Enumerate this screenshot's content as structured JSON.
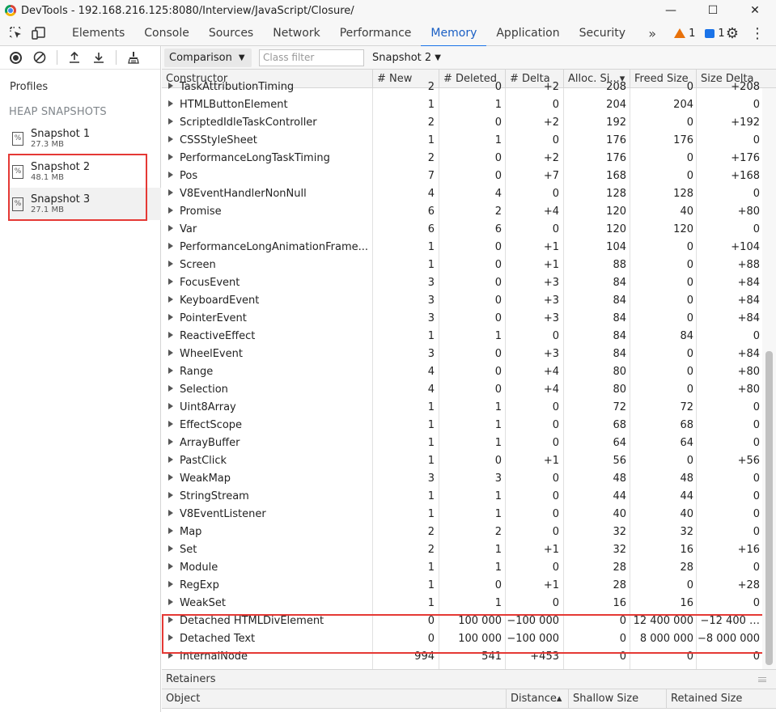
{
  "window": {
    "title": "DevTools - 192.168.216.125:8080/Interview/JavaScript/Closure/",
    "minimize": "—",
    "maximize": "☐",
    "close": "✕"
  },
  "tabs": [
    {
      "label": "Elements",
      "active": false
    },
    {
      "label": "Console",
      "active": false
    },
    {
      "label": "Sources",
      "active": false
    },
    {
      "label": "Network",
      "active": false
    },
    {
      "label": "Performance",
      "active": false
    },
    {
      "label": "Memory",
      "active": true
    },
    {
      "label": "Application",
      "active": false
    },
    {
      "label": "Security",
      "active": false
    }
  ],
  "tabbar": {
    "more": "»",
    "warnings": "1",
    "messages": "1",
    "warning_color": "#e8710a",
    "message_color": "#1a73e8",
    "accent_color": "#1a73e8"
  },
  "sidebar": {
    "profiles_label": "Profiles",
    "section_label": "HEAP SNAPSHOTS",
    "snapshots": [
      {
        "name": "Snapshot 1",
        "size": "27.3 MB"
      },
      {
        "name": "Snapshot 2",
        "size": "48.1 MB"
      },
      {
        "name": "Snapshot 3",
        "size": "27.1 MB"
      }
    ],
    "highlight_color": "#e53935"
  },
  "toolbar": {
    "view_mode": "Comparison",
    "class_filter_placeholder": "Class filter",
    "compare_target": "Snapshot 2"
  },
  "table": {
    "columns": [
      "Constructor",
      "# New",
      "# Deleted",
      "# Delta",
      "Alloc. Si...▾",
      "Freed Size",
      "Size Delta"
    ],
    "rows": [
      [
        "TaskAttributionTiming",
        "2",
        "0",
        "+2",
        "208",
        "0",
        "+208"
      ],
      [
        "HTMLButtonElement",
        "1",
        "1",
        "0",
        "204",
        "204",
        "0"
      ],
      [
        "ScriptedIdleTaskController",
        "2",
        "0",
        "+2",
        "192",
        "0",
        "+192"
      ],
      [
        "CSSStyleSheet",
        "1",
        "1",
        "0",
        "176",
        "176",
        "0"
      ],
      [
        "PerformanceLongTaskTiming",
        "2",
        "0",
        "+2",
        "176",
        "0",
        "+176"
      ],
      [
        "Pos",
        "7",
        "0",
        "+7",
        "168",
        "0",
        "+168"
      ],
      [
        "V8EventHandlerNonNull",
        "4",
        "4",
        "0",
        "128",
        "128",
        "0"
      ],
      [
        "Promise",
        "6",
        "2",
        "+4",
        "120",
        "40",
        "+80"
      ],
      [
        "Var",
        "6",
        "6",
        "0",
        "120",
        "120",
        "0"
      ],
      [
        "PerformanceLongAnimationFrame...",
        "1",
        "0",
        "+1",
        "104",
        "0",
        "+104"
      ],
      [
        "Screen",
        "1",
        "0",
        "+1",
        "88",
        "0",
        "+88"
      ],
      [
        "FocusEvent",
        "3",
        "0",
        "+3",
        "84",
        "0",
        "+84"
      ],
      [
        "KeyboardEvent",
        "3",
        "0",
        "+3",
        "84",
        "0",
        "+84"
      ],
      [
        "PointerEvent",
        "3",
        "0",
        "+3",
        "84",
        "0",
        "+84"
      ],
      [
        "ReactiveEffect",
        "1",
        "1",
        "0",
        "84",
        "84",
        "0"
      ],
      [
        "WheelEvent",
        "3",
        "0",
        "+3",
        "84",
        "0",
        "+84"
      ],
      [
        "Range",
        "4",
        "0",
        "+4",
        "80",
        "0",
        "+80"
      ],
      [
        "Selection",
        "4",
        "0",
        "+4",
        "80",
        "0",
        "+80"
      ],
      [
        "Uint8Array",
        "1",
        "1",
        "0",
        "72",
        "72",
        "0"
      ],
      [
        "EffectScope",
        "1",
        "1",
        "0",
        "68",
        "68",
        "0"
      ],
      [
        "ArrayBuffer",
        "1",
        "1",
        "0",
        "64",
        "64",
        "0"
      ],
      [
        "PastClick",
        "1",
        "0",
        "+1",
        "56",
        "0",
        "+56"
      ],
      [
        "WeakMap",
        "3",
        "3",
        "0",
        "48",
        "48",
        "0"
      ],
      [
        "StringStream",
        "1",
        "1",
        "0",
        "44",
        "44",
        "0"
      ],
      [
        "V8EventListener",
        "1",
        "1",
        "0",
        "40",
        "40",
        "0"
      ],
      [
        "Map",
        "2",
        "2",
        "0",
        "32",
        "32",
        "0"
      ],
      [
        "Set",
        "2",
        "1",
        "+1",
        "32",
        "16",
        "+16"
      ],
      [
        "Module",
        "1",
        "1",
        "0",
        "28",
        "28",
        "0"
      ],
      [
        "RegExp",
        "1",
        "0",
        "+1",
        "28",
        "0",
        "+28"
      ],
      [
        "WeakSet",
        "1",
        "1",
        "0",
        "16",
        "16",
        "0"
      ],
      [
        "Detached HTMLDivElement",
        "0",
        "100 000",
        "−100 000",
        "0",
        "12 400 000",
        "−12 400 …"
      ],
      [
        "Detached Text",
        "0",
        "100 000",
        "−100 000",
        "0",
        "8 000 000",
        "−8 000 000"
      ],
      [
        "InternalNode",
        "994",
        "541",
        "+453",
        "0",
        "0",
        "0"
      ]
    ],
    "highlighted_rows": [
      "Detached HTMLDivElement",
      "Detached Text"
    ]
  },
  "retainers": {
    "title": "Retainers",
    "columns": [
      "Object",
      "Distance▴",
      "Shallow Size",
      "Retained Size"
    ]
  }
}
